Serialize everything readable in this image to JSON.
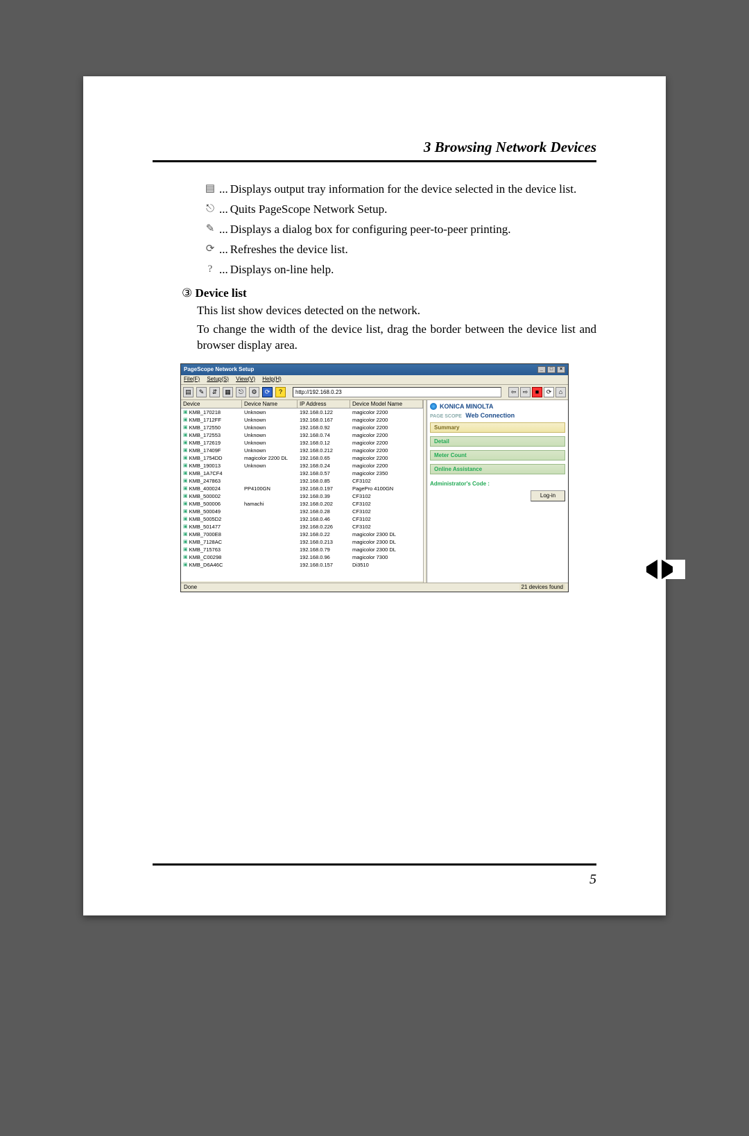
{
  "chapter_title": "3  Browsing Network Devices",
  "icons": [
    {
      "glyph": "▤",
      "text": "Displays output tray information for the device selected in the device list."
    },
    {
      "glyph": "⎋",
      "text": "Quits PageScope Network Setup."
    },
    {
      "glyph": "✎",
      "text": "Displays a dialog box for configuring peer-to-peer printing."
    },
    {
      "glyph": "⟳",
      "text": "Refreshes the device list."
    },
    {
      "glyph": "?",
      "text": "Displays on-line help."
    }
  ],
  "section": {
    "num": "③",
    "title": "Device list",
    "line1": "This list show devices detected on the network.",
    "line2": "To change the width of the device list, drag the border between the device list and browser display area."
  },
  "shot": {
    "title": "PageScope Network Setup",
    "menu": [
      "File(F)",
      "Setup(S)",
      "View(V)",
      "Help(H)"
    ],
    "url": "http://192.168.0.23",
    "columns": [
      "Device",
      "Device Name",
      "IP Address",
      "Device Model Name"
    ],
    "rows": [
      {
        "c1": "KMB_170218",
        "c2": "Unknown",
        "c3": "192.168.0.122",
        "c4": "magicolor 2200"
      },
      {
        "c1": "KMB_1712FF",
        "c2": "Unknown",
        "c3": "192.168.0.167",
        "c4": "magicolor 2200"
      },
      {
        "c1": "KMB_172550",
        "c2": "Unknown",
        "c3": "192.168.0.92",
        "c4": "magicolor 2200"
      },
      {
        "c1": "KMB_172553",
        "c2": "Unknown",
        "c3": "192.168.0.74",
        "c4": "magicolor 2200"
      },
      {
        "c1": "KMB_172619",
        "c2": "Unknown",
        "c3": "192.168.0.12",
        "c4": "magicolor 2200"
      },
      {
        "c1": "KMB_17409F",
        "c2": "Unknown",
        "c3": "192.168.0.212",
        "c4": "magicolor 2200"
      },
      {
        "c1": "KMB_1754DD",
        "c2": "magicolor 2200 DL",
        "c3": "192.168.0.65",
        "c4": "magicolor 2200"
      },
      {
        "c1": "KMB_190013",
        "c2": "Unknown",
        "c3": "192.168.0.24",
        "c4": "magicolor 2200"
      },
      {
        "c1": "KMB_1A7CF4",
        "c2": "",
        "c3": "192.168.0.57",
        "c4": "magicolor 2350"
      },
      {
        "c1": "KMB_247863",
        "c2": "",
        "c3": "192.168.0.85",
        "c4": "CF3102"
      },
      {
        "c1": "KMB_400024",
        "c2": "PP4100GN",
        "c3": "192.168.0.197",
        "c4": "PagePro 4100GN"
      },
      {
        "c1": "KMB_500002",
        "c2": "",
        "c3": "192.168.0.39",
        "c4": "CF3102"
      },
      {
        "c1": "KMB_500006",
        "c2": "hamachi",
        "c3": "192.168.0.202",
        "c4": "CF3102"
      },
      {
        "c1": "KMB_500049",
        "c2": "",
        "c3": "192.168.0.28",
        "c4": "CF3102"
      },
      {
        "c1": "KMB_5005D2",
        "c2": "",
        "c3": "192.168.0.46",
        "c4": "CF3102"
      },
      {
        "c1": "KMB_501477",
        "c2": "",
        "c3": "192.168.0.226",
        "c4": "CF3102"
      },
      {
        "c1": "KMB_7000E8",
        "c2": "",
        "c3": "192.168.0.22",
        "c4": "magicolor 2300 DL"
      },
      {
        "c1": "KMB_7128AC",
        "c2": "",
        "c3": "192.168.0.213",
        "c4": "magicolor 2300 DL"
      },
      {
        "c1": "KMB_715763",
        "c2": "",
        "c3": "192.168.0.79",
        "c4": "magicolor 2300 DL"
      },
      {
        "c1": "KMB_C00298",
        "c2": "",
        "c3": "192.168.0.96",
        "c4": "magicolor 7300"
      },
      {
        "c1": "KMB_D6A46C",
        "c2": "",
        "c3": "192.168.0.157",
        "c4": "Di3510"
      }
    ],
    "brand": "KONICA MINOLTA",
    "webconn_prefix": "PAGE SCOPE",
    "webconn": "Web Connection",
    "panels": [
      "Summary",
      "Detail",
      "Meter Count",
      "Online Assistance"
    ],
    "admin": "Administrator's Code :",
    "login": "Log-in",
    "status_left": "Done",
    "status_right": "21 devices found"
  },
  "page_number": "5"
}
